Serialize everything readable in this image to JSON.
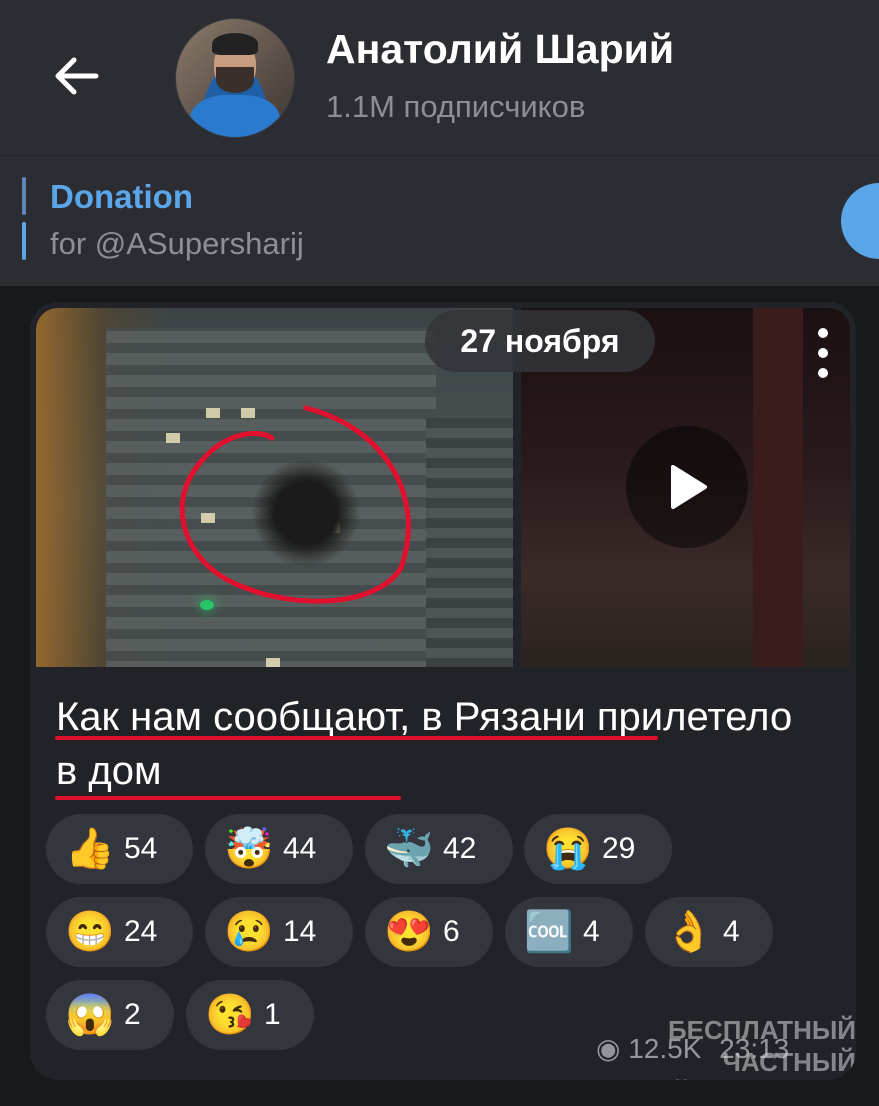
{
  "header": {
    "channel_name": "Анатолий Шарий",
    "subscribers": "1.1M подписчиков",
    "back_icon": "arrow-left-icon"
  },
  "pinned": {
    "title": "Donation",
    "text": "for @ASupersharij"
  },
  "post": {
    "date": "27 ноября",
    "caption": "Как нам сообщают, в Рязани прилетело в дом",
    "views": "12.5K",
    "time": "23:13",
    "watermark": "БЕСПЛАТНЫЙ ЧАСТНЫЙ\nШАРИЙ 👉 Sharij.net",
    "reactions": [
      {
        "emoji": "👍",
        "count": "54"
      },
      {
        "emoji": "🤯",
        "count": "44"
      },
      {
        "emoji": "🐳",
        "count": "42"
      },
      {
        "emoji": "😭",
        "count": "29"
      },
      {
        "emoji": "😁",
        "count": "24"
      },
      {
        "emoji": "😢",
        "count": "14"
      },
      {
        "emoji": "😍",
        "count": "6"
      },
      {
        "emoji": "🆒",
        "count": "4"
      },
      {
        "emoji": "👌",
        "count": "4"
      },
      {
        "emoji": "😱",
        "count": "2"
      },
      {
        "emoji": "😘",
        "count": "1"
      }
    ]
  },
  "colors": {
    "accent": "#5aa6e8",
    "header_bg": "#2b2d33",
    "background": "#17191d",
    "underline": "#e0102e"
  }
}
